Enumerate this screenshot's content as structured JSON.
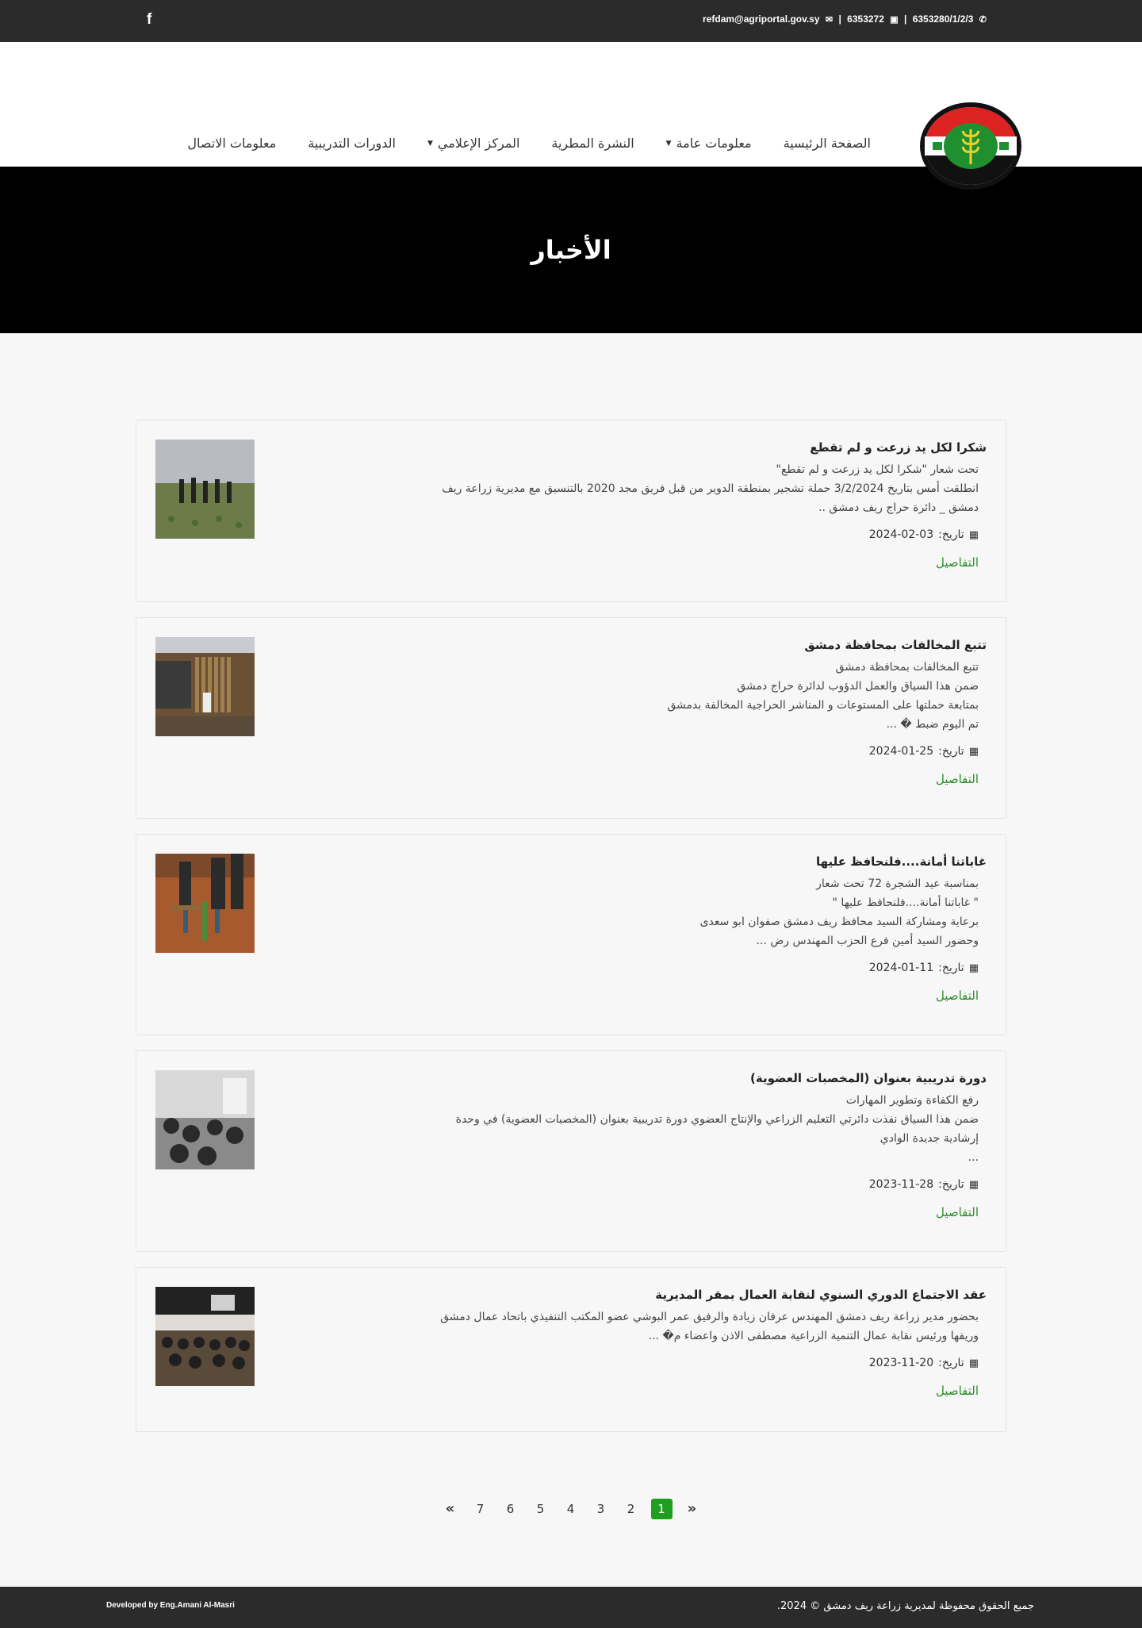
{
  "topbar": {
    "facebook_icon": "f",
    "email": "refdam@agriportal.gov.sy",
    "fax": "6353272",
    "phone": "6353280/1/2/3"
  },
  "nav": {
    "items": [
      {
        "label": "الصفحة الرئيسية",
        "dropdown": false
      },
      {
        "label": "معلومات عامة",
        "dropdown": true
      },
      {
        "label": "النشرة المطرية",
        "dropdown": false
      },
      {
        "label": "المركز الإعلامي",
        "dropdown": true
      },
      {
        "label": "الدورات التدريبية",
        "dropdown": false
      },
      {
        "label": "معلومات الاتصال",
        "dropdown": false
      }
    ]
  },
  "banner": {
    "title": "الأخبار"
  },
  "news": [
    {
      "title": "شكرا لكل يد زرعت و لم تقطع",
      "excerpt": [
        "تحت شعار \"شكرا لكل يد زرعت و لم تقطع\"",
        "انطلقت أمس بتاريخ 3/2/2024 حملة تشجير بمنطقة الدوير من قبل فريق مجد 2020 بالتنسيق مع مديرية زراعة ريف",
        "دمشق _ دائرة حراج ريف دمشق .."
      ],
      "date_label": "تاريخ:",
      "date": "2024-02-03",
      "details": "التفاصيل"
    },
    {
      "title": "تتبع المخالفات بمحافظة دمشق",
      "excerpt": [
        "تتبع المخالفات بمحافظة دمشق",
        "ضمن هذا السياق والعمل الدؤوب لدائرة حراج دمشق",
        "بمتابعة حملتها على المستوعات و المناشر الحراجية المخالفة بدمشق",
        "تم اليوم ضبط � ..."
      ],
      "date_label": "تاريخ:",
      "date": "2024-01-25",
      "details": "التفاصيل"
    },
    {
      "title": "غاباتنا أمانة....فلنحافظ عليها",
      "excerpt": [
        "بمناسبة عيد الشجرة 72 تحت شعار",
        "\" غاباتنا أمانة....فلنحافظ عليها \"",
        "برعاية ومشاركة السيد محافظ ريف دمشق صفوان ابو سعدى",
        "وحضور السيد أمين فرع الحزب المهندس رض ..."
      ],
      "date_label": "تاريخ:",
      "date": "2024-01-11",
      "details": "التفاصيل"
    },
    {
      "title": "دورة تدريبية بعنوان (المخصبات العضوية)",
      "excerpt": [
        "رفع الكفاءة وتطوير المهارات",
        "ضمن هذا السياق نفذت دائرتي التعليم الزراعي والإنتاج العضوي دورة تدريبية بعنوان (المخصبات العضوية) في وحدة",
        "إرشادية جديدة الوادي",
        "..."
      ],
      "date_label": "تاريخ:",
      "date": "2023-11-28",
      "details": "التفاصيل"
    },
    {
      "title": "عقد الاجتماع الدوري السنوي لنقابة العمال بمقر المديرية",
      "excerpt": [
        "بحضور مدير زراعة ريف دمشق المهندس عرفان زيادة والرفيق عمر البوشي عضو المكتب التنفيذي باتحاد عمال دمشق",
        "وريفها ورئيس نقابة عمال التنمية الزراعية مصطفى الاذن واعضاء م� ..."
      ],
      "date_label": "تاريخ:",
      "date": "2023-11-20",
      "details": "التفاصيل"
    }
  ],
  "pagination": {
    "prev": "«",
    "pages": [
      "1",
      "2",
      "3",
      "4",
      "5",
      "6",
      "7"
    ],
    "active": "1",
    "next": "»"
  },
  "footer": {
    "credit": "Developed by Eng.Amani Al-Masri",
    "copyright": "جميع الحقوق محفوظة لمديرية زراعة ريف دمشق © 2024."
  },
  "colors": {
    "accent_green": "#1f9e1f",
    "link_green": "#2e8b2e",
    "dark_bar": "#2b2b2b"
  }
}
